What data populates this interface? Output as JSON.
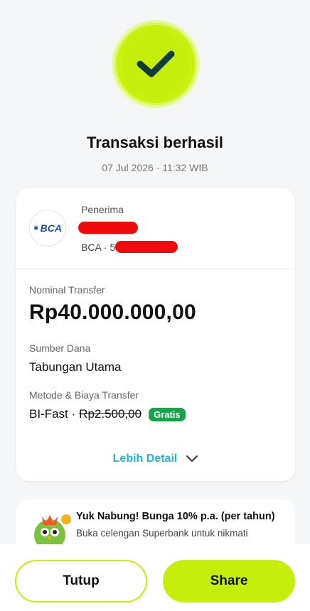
{
  "status": {
    "title": "Transaksi berhasil",
    "datetime": "07 Jul 2026 · 11:32 WIB"
  },
  "recipient": {
    "label": "Penerima",
    "bank_logo_text": "BCA",
    "bank_prefix": "BCA · 5"
  },
  "transfer": {
    "amount_label": "Nominal Transfer",
    "amount": "Rp40.000.000,00",
    "source_label": "Sumber Dana",
    "source": "Tabungan Utama",
    "method_label": "Metode & Biaya Transfer",
    "method": "BI-Fast ·",
    "original_fee": "Rp2.500,00",
    "fee_badge": "Gratis"
  },
  "detail_link": "Lebih Detail",
  "promo": {
    "title": "Yuk Nabung! Bunga 10% p.a. (per tahun)",
    "description": "Buka celengan Superbank untuk nikmati"
  },
  "actions": {
    "close_label": "Tutup",
    "share_label": "Share"
  },
  "colors": {
    "accent": "#c6ee0d",
    "badge_green": "#19a34a",
    "link": "#1fb8d6",
    "redaction": "#ef0b0b"
  }
}
